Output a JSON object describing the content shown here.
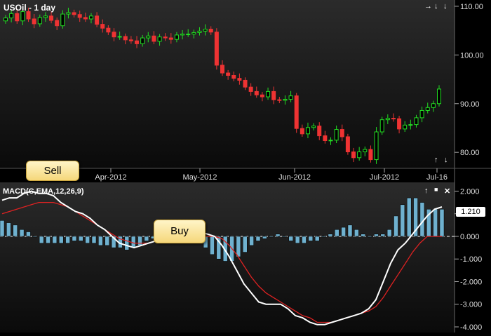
{
  "price_panel": {
    "title": "USOil - 1 day",
    "y_ticks": [
      "110.00",
      "100.00",
      "90.00",
      "80.00"
    ],
    "x_ticks": [
      "Apr-2012",
      "May-2012",
      "Jun-2012",
      "Jul-2012",
      "Jul-16"
    ],
    "controls": {
      "right": "→",
      "down": "↓",
      "close": "↓",
      "up": "↑",
      "down2": "↓"
    }
  },
  "macd_panel": {
    "title": "MACD(C,EMA,12,26,9)",
    "y_ticks": [
      "2.000",
      "1.000",
      "0.000",
      "-1.000",
      "-2.000",
      "-3.000",
      "-4.000"
    ],
    "current_value": "1.210",
    "controls": {
      "up": "↑",
      "window": "■",
      "close": "✕"
    }
  },
  "callouts": {
    "sell": "Sell",
    "buy": "Buy"
  },
  "colors": {
    "up_candle": "#22dd22",
    "down_candle": "#ee3333",
    "histogram": "#6fb1cf",
    "macd_line": "#ffffff",
    "signal_line": "#dd2222"
  },
  "chart_data": [
    {
      "type": "candlestick",
      "title": "USOil - 1 day",
      "x_tick_labels": [
        "Apr-2012",
        "May-2012",
        "Jun-2012",
        "Jul-2012",
        "Jul-16"
      ],
      "ylim": [
        77,
        111
      ],
      "close": [
        107.6,
        108.5,
        107.0,
        108.9,
        107.4,
        106.4,
        107.7,
        108.0,
        107.1,
        106.0,
        108.4,
        108.7,
        108.3,
        107.7,
        107.4,
        108.0,
        106.3,
        105.5,
        104.7,
        103.7,
        103.8,
        103.1,
        102.9,
        102.3,
        103.5,
        103.9,
        102.8,
        103.7,
        103.5,
        103.2,
        104.1,
        104.3,
        104.3,
        104.6,
        104.9,
        105.3,
        104.7,
        97.9,
        96.3,
        95.8,
        95.2,
        94.8,
        93.4,
        92.5,
        91.8,
        91.4,
        92.5,
        90.8,
        90.7,
        90.9,
        91.6,
        84.9,
        83.8,
        85.1,
        85.4,
        83.4,
        82.4,
        82.5,
        84.7,
        83.2,
        80.1,
        78.9,
        80.1,
        80.6,
        78.5,
        84.2,
        86.7,
        87.0,
        86.9,
        84.8,
        85.6,
        85.7,
        87.1,
        88.6,
        89.2,
        90.0,
        93.0
      ]
    },
    {
      "type": "bar+line",
      "title": "MACD(C,EMA,12,26,9)",
      "ylim": [
        -4,
        2.2
      ],
      "series": [
        {
          "name": "MACD",
          "values": [
            1.6,
            1.7,
            1.7,
            1.9,
            2.0,
            1.9,
            1.9,
            1.8,
            1.5,
            1.3,
            1.1,
            1.0,
            0.8,
            0.5,
            0.3,
            0.0,
            -0.3,
            -0.4,
            -0.5,
            -0.4,
            -0.3,
            -0.2,
            -0.1,
            0.0,
            0.1,
            0.1,
            0.1,
            0.2,
            0.1,
            0.0,
            -0.4,
            -0.9,
            -1.5,
            -2.1,
            -2.5,
            -2.9,
            -3.0,
            -3.0,
            -3.0,
            -3.2,
            -3.5,
            -3.6,
            -3.8,
            -3.9,
            -3.9,
            -3.8,
            -3.7,
            -3.6,
            -3.5,
            -3.4,
            -3.2,
            -2.8,
            -2.0,
            -1.2,
            -0.6,
            -0.3,
            0.1,
            0.5,
            0.9,
            1.2,
            1.3
          ]
        },
        {
          "name": "Signal",
          "values": [
            1.0,
            1.1,
            1.2,
            1.3,
            1.4,
            1.5,
            1.5,
            1.5,
            1.4,
            1.3,
            1.1,
            0.9,
            0.7,
            0.5,
            0.3,
            0.1,
            -0.1,
            -0.2,
            -0.3,
            -0.3,
            -0.3,
            -0.2,
            -0.2,
            -0.1,
            0.0,
            0.0,
            0.0,
            0.0,
            0.0,
            0.0,
            -0.1,
            -0.4,
            -0.8,
            -1.3,
            -1.8,
            -2.2,
            -2.5,
            -2.7,
            -2.9,
            -3.1,
            -3.3,
            -3.5,
            -3.6,
            -3.8,
            -3.8,
            -3.8,
            -3.7,
            -3.6,
            -3.5,
            -3.4,
            -3.3,
            -3.1,
            -2.7,
            -2.2,
            -1.7,
            -1.2,
            -0.7,
            -0.3,
            0.0,
            0.0,
            0.0
          ]
        },
        {
          "name": "Histogram",
          "values": [
            0.7,
            0.6,
            0.5,
            0.3,
            0.2,
            0.0,
            -0.3,
            -0.3,
            -0.3,
            -0.3,
            -0.3,
            -0.2,
            -0.2,
            -0.3,
            -0.3,
            -0.4,
            -0.4,
            -0.5,
            -0.5,
            -0.6,
            -0.5,
            -0.4,
            -0.2,
            -0.1,
            -0.2,
            -0.3,
            -0.3,
            -0.2,
            -0.1,
            0.0,
            -0.3,
            -0.5,
            -0.8,
            -1.0,
            -1.1,
            -1.1,
            -0.9,
            -0.7,
            -0.4,
            -0.2,
            -0.1,
            0.0,
            0.1,
            0.0,
            -0.2,
            -0.3,
            -0.3,
            -0.2,
            -0.2,
            0.0,
            0.1,
            0.3,
            0.4,
            0.5,
            0.3,
            0.1,
            0.0,
            0.1,
            0.1,
            0.3,
            0.9,
            1.4,
            1.7,
            1.7,
            1.5,
            1.2,
            1.2,
            1.2
          ]
        }
      ]
    }
  ]
}
